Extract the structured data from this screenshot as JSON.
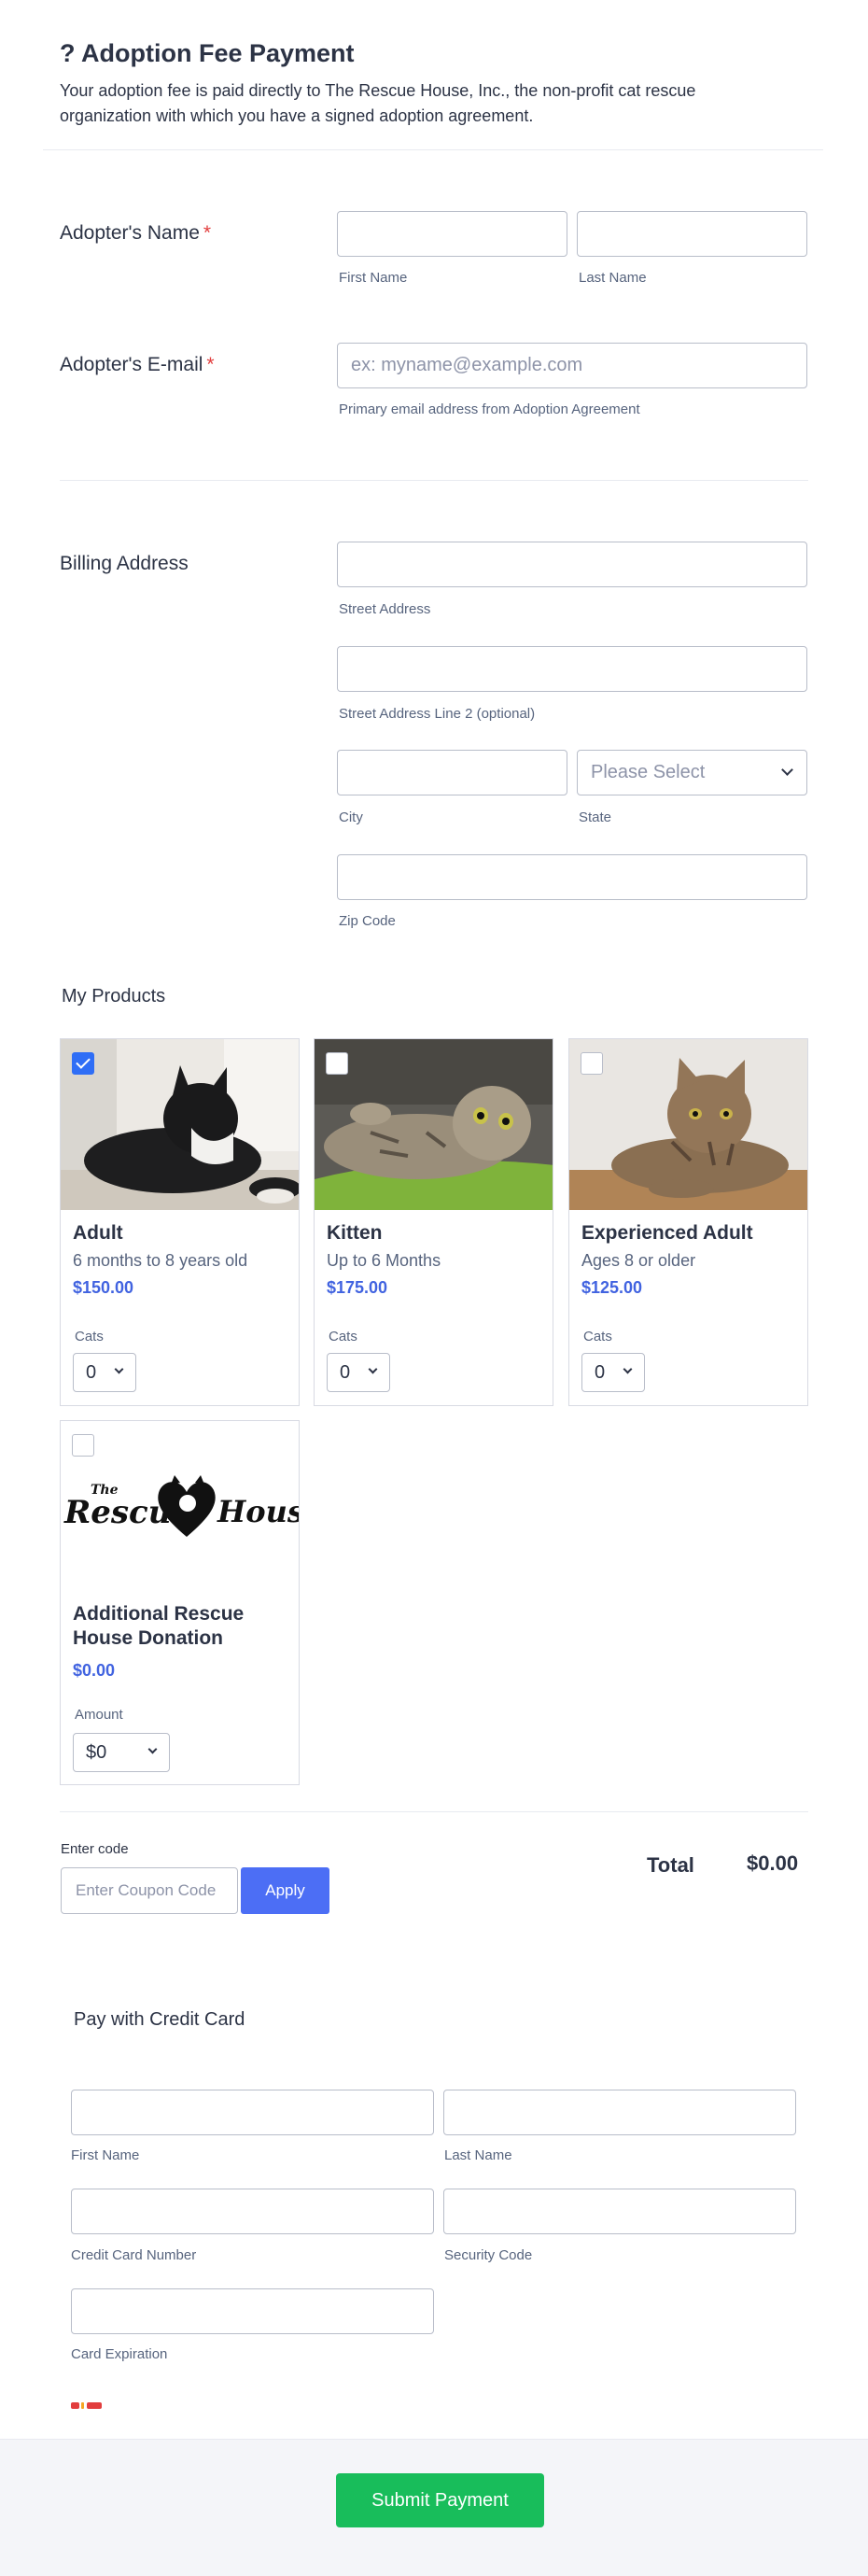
{
  "header": {
    "title": "? Adoption Fee Payment",
    "subtitle": "Your adoption fee is paid directly to The Rescue House, Inc., the non-profit cat rescue organization with which you have a signed adoption agreement."
  },
  "name_field": {
    "label": "Adopter's Name",
    "required_mark": "*",
    "first_label": "First Name",
    "last_label": "Last Name"
  },
  "email_field": {
    "label": "Adopter's E-mail",
    "required_mark": "*",
    "placeholder": "ex: myname@example.com",
    "help": "Primary email address from Adoption Agreement"
  },
  "billing": {
    "label": "Billing Address",
    "street_label": "Street Address",
    "street2_label": "Street Address Line 2 (optional)",
    "city_label": "City",
    "state_label": "State",
    "state_placeholder": "Please Select",
    "zip_label": "Zip Code"
  },
  "products": {
    "title": "My Products",
    "items": [
      {
        "name": "Adult",
        "desc": "6 months to 8 years old",
        "price": "$150.00",
        "qty_label": "Cats",
        "qty": "0",
        "checked": true
      },
      {
        "name": "Kitten",
        "desc": "Up to 6 Months",
        "price": "$175.00",
        "qty_label": "Cats",
        "qty": "0",
        "checked": false
      },
      {
        "name": "Experienced Adult",
        "desc": "Ages 8 or older",
        "price": "$125.00",
        "qty_label": "Cats",
        "qty": "0",
        "checked": false
      },
      {
        "name": "Additional Rescue House Donation",
        "price": "$0.00",
        "qty_label": "Amount",
        "qty": "$0",
        "checked": false,
        "logo_text_left": "The",
        "logo_text_main_1": "Rescue",
        "logo_text_main_2": "House"
      }
    ]
  },
  "coupon": {
    "label": "Enter code",
    "placeholder": "Enter Coupon Code",
    "button": "Apply"
  },
  "total": {
    "label": "Total",
    "value": "$0.00"
  },
  "payment": {
    "title": "Pay with Credit Card",
    "first_label": "First Name",
    "last_label": "Last Name",
    "card_label": "Credit Card Number",
    "security_label": "Security Code",
    "expiration_label": "Card Expiration"
  },
  "submit": {
    "label": "Submit Payment"
  },
  "colors": {
    "accent": "#4c6ef5",
    "price": "#4163e0",
    "submit": "#18bd5b",
    "required": "#e23e3e"
  }
}
